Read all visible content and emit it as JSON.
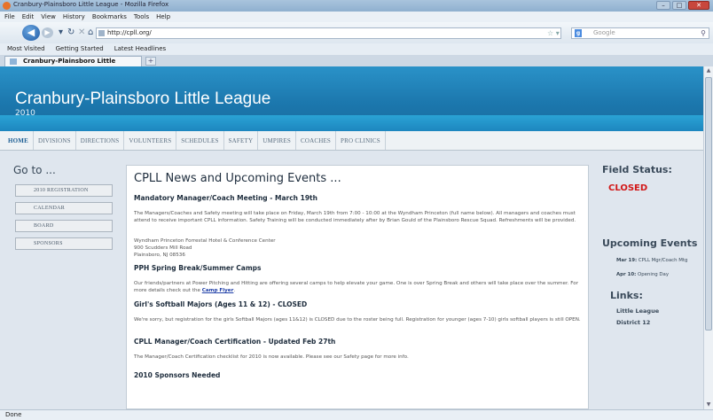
{
  "window": {
    "title": "Cranbury-Plainsboro Little League - Mozilla Firefox"
  },
  "menu": [
    "File",
    "Edit",
    "View",
    "History",
    "Bookmarks",
    "Tools",
    "Help"
  ],
  "nav": {
    "url": "http://cpll.org/",
    "search_placeholder": "Google"
  },
  "bookmarks": [
    "Most Visited",
    "Getting Started",
    "Latest Headlines"
  ],
  "tab": {
    "label": "Cranbury-Plainsboro Little League",
    "new_tab": "+"
  },
  "site": {
    "title": "Cranbury-Plainsboro Little League",
    "year": "2010",
    "nav": [
      "HOME",
      "DIVISIONS",
      "DIRECTIONS",
      "VOLUNTEERS",
      "SCHEDULES",
      "SAFETY",
      "UMPIRES",
      "COACHES",
      "PRO CLINICS"
    ]
  },
  "sidebar": {
    "heading": "Go to ...",
    "items": [
      "2010 REGISTRATION",
      "CALENDAR",
      "BOARD",
      "SPONSORS"
    ]
  },
  "main": {
    "heading": "CPLL News and Upcoming Events ...",
    "sections": [
      {
        "title": "Mandatory Manager/Coach Meeting - March 19th",
        "body": "The Managers/Coaches and Safety meeting will take place on Friday, March 19th from 7:00 - 10:00 at the Wyndham Princeton (full name below). All managers and coaches must attend to receive important CPLL information. Safety Training will be conducted immediately after by Brian Gould of the Plainsboro Rescue Squad. Refreshments will be provided.",
        "address": [
          "Wyndham Princeton Forrestal Hotel & Conference Center",
          "900 Scudders Mill Road",
          "Plainsboro, NJ 08536"
        ]
      },
      {
        "title": "PPH Spring Break/Summer Camps",
        "body": "Our friends/partners at Power Pitching and Hitting are offering several camps to help elevate your game. One is over Spring Break and others will take place over the summer. For more details check out the",
        "link": "Camp Flyer",
        "tail": "."
      },
      {
        "title": "Girl's Softball Majors (Ages 11 & 12) - CLOSED",
        "body": "We're sorry, but registration for the girls Softball Majors (ages 11&12) is CLOSED due to the roster being full. Registration for younger (ages 7-10) girls softball players is still OPEN."
      },
      {
        "title": "CPLL Manager/Coach Certification - Updated Feb 27th",
        "body": "The Manager/Coach Certification checklist for 2010 is now available. Please see our Safety page for more info."
      },
      {
        "title": "2010 Sponsors Needed"
      }
    ]
  },
  "right": {
    "field_status_label": "Field Status:",
    "field_status_value": "CLOSED",
    "events_heading": "Upcoming Events",
    "events": [
      {
        "date": "Mar 19:",
        "text": "CPLL Mgr/Coach Mtg"
      },
      {
        "date": "Apr 10:",
        "text": "Opening Day"
      }
    ],
    "links_heading": "Links:",
    "links": [
      "Little League",
      "District 12"
    ]
  },
  "status": {
    "text": "Done"
  },
  "colors": {
    "header": "#1b76ac",
    "closed": "#d21818",
    "link": "#1f3fa8"
  }
}
